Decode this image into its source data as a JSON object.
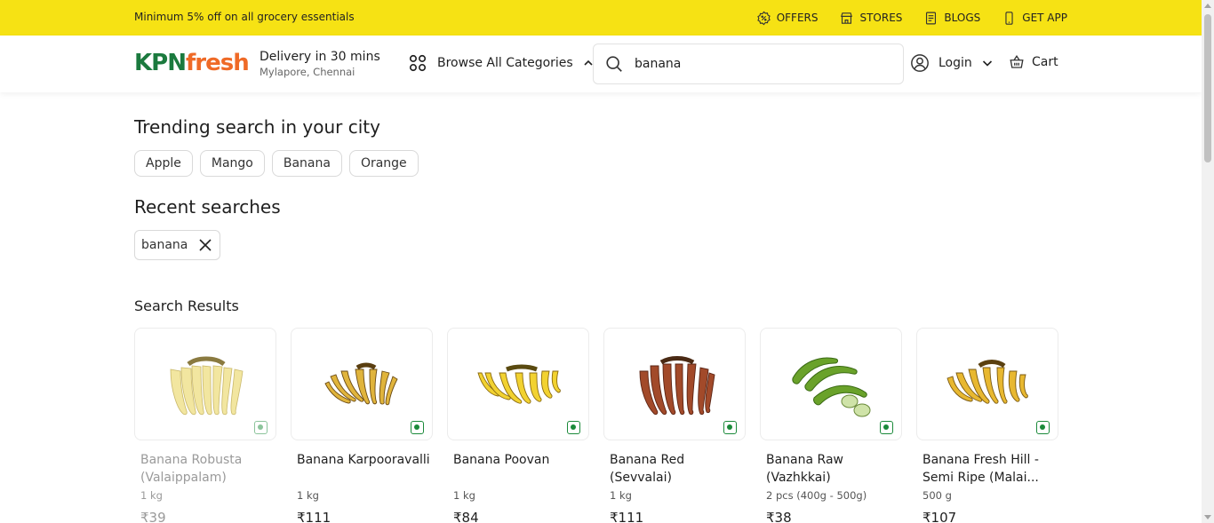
{
  "promo": {
    "text": "Minimum 5% off on all grocery essentials",
    "links": [
      {
        "label": "OFFERS",
        "icon": "offer-badge-icon"
      },
      {
        "label": "STORES",
        "icon": "store-icon"
      },
      {
        "label": "BLOGS",
        "icon": "blog-icon"
      },
      {
        "label": "GET APP",
        "icon": "phone-icon"
      }
    ],
    "bg_color": "#f6e214"
  },
  "header": {
    "logo": {
      "part1": "KPN",
      "part2": "fresh"
    },
    "delivery": {
      "title": "Delivery in 30 mins",
      "location": "Mylapore, Chennai"
    },
    "browse_label": "Browse All Categories",
    "search": {
      "value": "banana",
      "placeholder": "Search"
    },
    "login_label": "Login",
    "cart_label": "Cart"
  },
  "trending": {
    "title": "Trending search in your city",
    "items": [
      "Apple",
      "Mango",
      "Banana",
      "Orange"
    ]
  },
  "recent": {
    "title": "Recent searches",
    "items": [
      "banana"
    ]
  },
  "results": {
    "title": "Search Results",
    "products": [
      {
        "name": "Banana Robusta (Valaippalam)",
        "qty": "1 kg",
        "price": "₹39",
        "color": "#f2e6a0"
      },
      {
        "name": "Banana Karpooravalli",
        "qty": "1 kg",
        "price": "₹111",
        "color": "#e0b43c"
      },
      {
        "name": "Banana Poovan",
        "qty": "1 kg",
        "price": "₹84",
        "color": "#f2d230"
      },
      {
        "name": "Banana Red (Sevvalai)",
        "qty": "1 kg",
        "price": "₹111",
        "color": "#a24a2a"
      },
      {
        "name": "Banana Raw (Vazhkkai)",
        "qty": "2 pcs (400g - 500g)",
        "price": "₹38",
        "color": "#6aa22a"
      },
      {
        "name": "Banana Fresh Hill - Semi Ripe (Malai...",
        "qty": "500 g",
        "price": "₹107",
        "color": "#e8b830"
      }
    ]
  },
  "colors": {
    "brand_green": "#1b7a3e",
    "brand_orange": "#ef6a27",
    "veg_green": "#1b8a3a"
  }
}
